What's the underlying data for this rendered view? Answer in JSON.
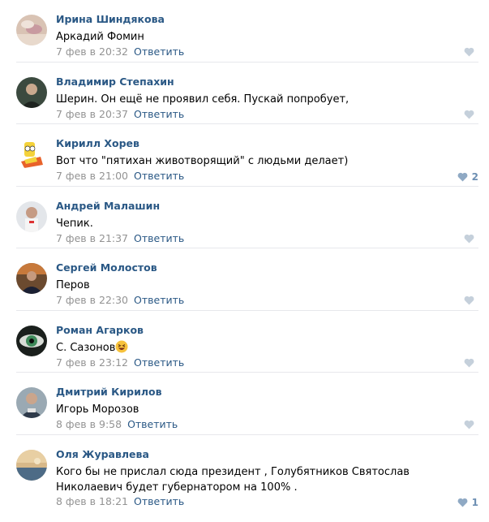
{
  "comments": [
    {
      "author": "Ирина Шиндякова",
      "text": "Аркадий Фомин",
      "date": "7 фев в 20:32",
      "reply": "Ответить",
      "likes": ""
    },
    {
      "author": "Владимир Степахин",
      "text": "Шерин. Он ещё не проявил себя. Пускай попробует,",
      "date": "7 фев в 20:37",
      "reply": "Ответить",
      "likes": ""
    },
    {
      "author": "Кирилл Хорев",
      "text": "Вот что \"пятихан животворящий\" с людьми делает)",
      "date": "7 фев в 21:00",
      "reply": "Ответить",
      "likes": "2"
    },
    {
      "author": "Андрей Малашин",
      "text": "Чепик.",
      "date": "7 фев в 21:37",
      "reply": "Ответить",
      "likes": ""
    },
    {
      "author": "Сергей Молостов",
      "text": "Перов",
      "date": "7 фев в 22:30",
      "reply": "Ответить",
      "likes": ""
    },
    {
      "author": "Роман Агарков",
      "text": "С. Сазонов",
      "date": "7 фев в 23:12",
      "reply": "Ответить",
      "likes": ""
    },
    {
      "author": "Дмитрий Кирилов",
      "text": "Игорь Морозов",
      "date": "8 фев в 9:58",
      "reply": "Ответить",
      "likes": ""
    },
    {
      "author": "Оля Журавлева",
      "text": "Кого бы не прислал сюда президент , Голубятников Святослав Николаевич будет губернатором на 100% .",
      "date": "8 фев в 18:21",
      "reply": "Ответить",
      "likes": "1"
    }
  ],
  "icons": {
    "like": "heart-icon",
    "emoji": "laughing-emoji-icon"
  },
  "colors": {
    "author": "#2a5885",
    "date": "#939393",
    "reply": "#2a5885",
    "like": "#b7c7d9",
    "like_count": "#6d8fb3",
    "divider": "#e7e8ec"
  }
}
